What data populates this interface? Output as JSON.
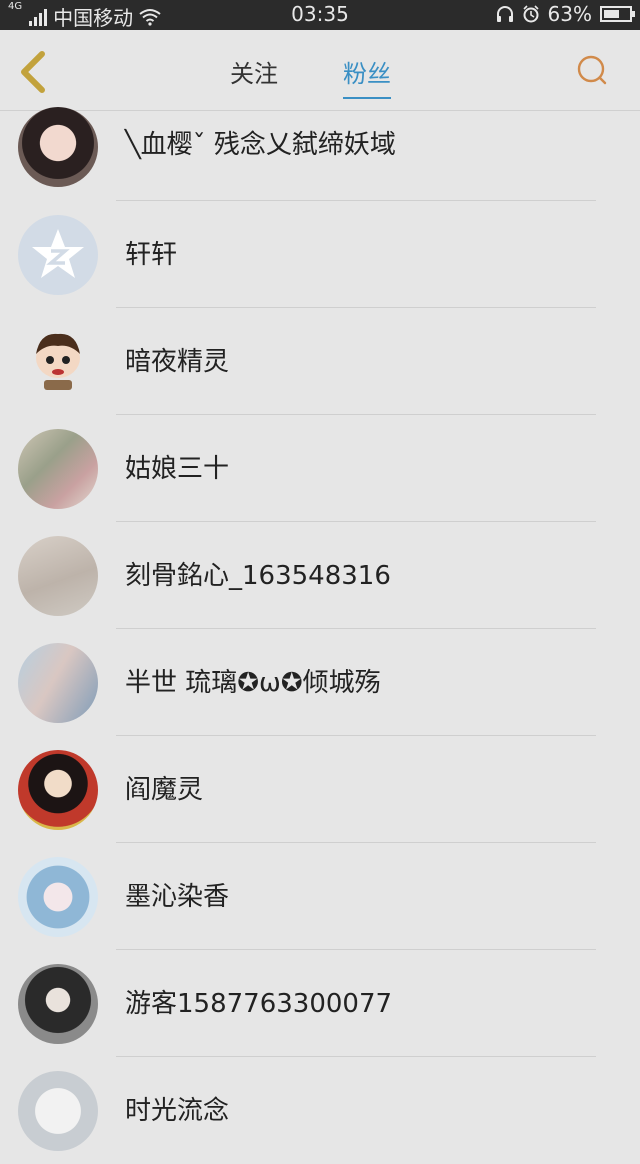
{
  "status_bar": {
    "network_type": "4G",
    "carrier": "中国移动",
    "time": "03:35",
    "battery_percent": "63%",
    "battery_level": 0.63
  },
  "header": {
    "tabs": [
      {
        "label": "关注",
        "active": false
      },
      {
        "label": "粉丝",
        "active": true
      }
    ],
    "accent_color": "#3a8fc4",
    "back_icon_color": "#c2a23c",
    "search_icon_color": "#d18a4a"
  },
  "fans": [
    {
      "name": "╲血樱ˇ  残念乂弑缔妖域",
      "avatar": "photo-avatar"
    },
    {
      "name": "轩轩",
      "avatar": "qzone-default-avatar"
    },
    {
      "name": "暗夜精灵",
      "avatar": "cartoon-avatar"
    },
    {
      "name": "姑娘三十",
      "avatar": "book-cover-avatar"
    },
    {
      "name": "刻骨銘心_163548316",
      "avatar": "photo-avatar"
    },
    {
      "name": "半世 琉璃✪ω✪倾城殇",
      "avatar": "photo-avatar"
    },
    {
      "name": "阎魔灵",
      "avatar": "anime-avatar"
    },
    {
      "name": "墨沁染香",
      "avatar": "anime-avatar"
    },
    {
      "name": "游客1587763300077",
      "avatar": "anime-avatar"
    },
    {
      "name": "时光流念",
      "avatar": "sketch-avatar"
    }
  ]
}
